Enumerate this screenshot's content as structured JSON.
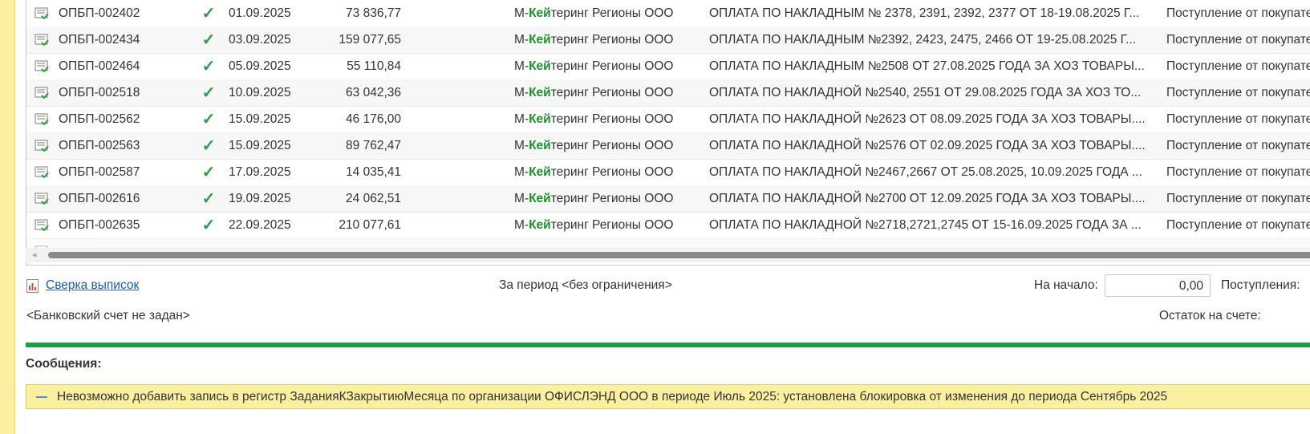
{
  "table": {
    "rows": [
      {
        "number": "ОПБП-002402",
        "date": "01.09.2025",
        "sum": "73 836,77",
        "cp_prefix": "М-",
        "cp_highlight": "Кей",
        "cp_suffix": "теринг Регионы ООО",
        "purpose": "ОПЛАТА ПО НАКЛАДНЫМ № 2378, 2391, 2392, 2377 ОТ 18-19.08.2025 Г...",
        "operation": "Поступление от покупателя"
      },
      {
        "number": "ОПБП-002434",
        "date": "03.09.2025",
        "sum": "159 077,65",
        "cp_prefix": "М-",
        "cp_highlight": "Кей",
        "cp_suffix": "теринг Регионы ООО",
        "purpose": "ОПЛАТА ПО НАКЛАДНЫМ №2392, 2423, 2475, 2466 ОТ 19-25.08.2025 Г...",
        "operation": "Поступление от покупателя"
      },
      {
        "number": "ОПБП-002464",
        "date": "05.09.2025",
        "sum": "55 110,84",
        "cp_prefix": "М-",
        "cp_highlight": "Кей",
        "cp_suffix": "теринг Регионы ООО",
        "purpose": "ОПЛАТА ПО НАКЛАДНЫМ №2508 ОТ 27.08.2025 ГОДА ЗА ХОЗ ТОВАРЫ...",
        "operation": "Поступление от покупателя"
      },
      {
        "number": "ОПБП-002518",
        "date": "10.09.2025",
        "sum": "63 042,36",
        "cp_prefix": "М-",
        "cp_highlight": "Кей",
        "cp_suffix": "теринг Регионы ООО",
        "purpose": "ОПЛАТА ПО НАКЛАДНОЙ №2540, 2551 ОТ 29.08.2025 ГОДА ЗА ХОЗ ТО...",
        "operation": "Поступление от покупателя"
      },
      {
        "number": "ОПБП-002562",
        "date": "15.09.2025",
        "sum": "46 176,00",
        "cp_prefix": "М-",
        "cp_highlight": "Кей",
        "cp_suffix": "теринг Регионы ООО",
        "purpose": "ОПЛАТА ПО НАКЛАДНОЙ №2623 ОТ 08.09.2025 ГОДА ЗА ХОЗ ТОВАРЫ....",
        "operation": "Поступление от покупателя"
      },
      {
        "number": "ОПБП-002563",
        "date": "15.09.2025",
        "sum": "89 762,47",
        "cp_prefix": "М-",
        "cp_highlight": "Кей",
        "cp_suffix": "теринг Регионы ООО",
        "purpose": "ОПЛАТА ПО НАКЛАДНОЙ №2576 ОТ 02.09.2025 ГОДА ЗА ХОЗ ТОВАРЫ....",
        "operation": "Поступление от покупателя"
      },
      {
        "number": "ОПБП-002587",
        "date": "17.09.2025",
        "sum": "14 035,41",
        "cp_prefix": "М-",
        "cp_highlight": "Кей",
        "cp_suffix": "теринг Регионы ООО",
        "purpose": "ОПЛАТА ПО НАКЛАДНОЙ №2467,2667 ОТ 25.08.2025, 10.09.2025 ГОДА ...",
        "operation": "Поступление от покупателя"
      },
      {
        "number": "ОПБП-002616",
        "date": "19.09.2025",
        "sum": "24 062,51",
        "cp_prefix": "М-",
        "cp_highlight": "Кей",
        "cp_suffix": "теринг Регионы ООО",
        "purpose": "ОПЛАТА ПО НАКЛАДНОЙ №2700 ОТ 12.09.2025 ГОДА ЗА ХОЗ ТОВАРЫ....",
        "operation": "Поступление от покупателя"
      },
      {
        "number": "ОПБП-002635",
        "date": "22.09.2025",
        "sum": "210 077,61",
        "cp_prefix": "М-",
        "cp_highlight": "Кей",
        "cp_suffix": "теринг Регионы ООО",
        "purpose": "ОПЛАТА ПО НАКЛАДНОЙ №2718,2721,2745 ОТ 15-16.09.2025 ГОДА ЗА ...",
        "operation": "Поступление от покупателя"
      }
    ],
    "check_glyph": "✓"
  },
  "footer": {
    "reconcile_link": "Сверка выписок",
    "period_text": "За период <без ограничения>",
    "start_label": "На начало:",
    "start_value": "0,00",
    "post_label": "Поступления:",
    "bank_account": "<Банковский счет не задан>",
    "balance_label": "Остаток на счете:"
  },
  "messages": {
    "title": "Сообщения:",
    "items": [
      {
        "text": "Невозможно добавить запись в регистр ЗаданияКЗакрытиюМесяца по организации ОФИСЛЭНД ООО в периоде Июль 2025: установлена блокировка от изменения до периода Сентябрь 2025"
      }
    ]
  },
  "colors": {
    "accent_green": "#1e9d45",
    "message_bg": "#fbf0a0",
    "link": "#1f5aa8"
  }
}
